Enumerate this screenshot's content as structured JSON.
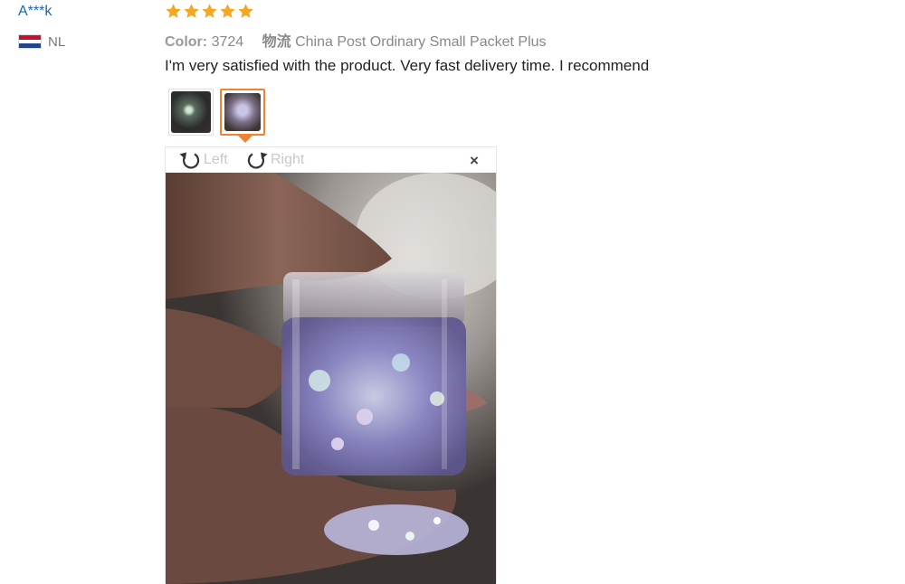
{
  "reviewer": {
    "name": "A***k",
    "country": "NL"
  },
  "rating": {
    "stars": 5,
    "color": "#f5a623"
  },
  "meta": {
    "color_label": "Color:",
    "color_value": "3724",
    "shipping_label": "物流",
    "shipping_value": "China Post Ordinary Small Packet Plus"
  },
  "review_text": "I'm very satisfied with the product. Very fast delivery time. I recommend",
  "thumbnails": [
    {
      "selected": false
    },
    {
      "selected": true
    }
  ],
  "viewer": {
    "rotate_left": "Left",
    "rotate_right": "Right",
    "close": "×"
  },
  "accent_color": "#f08233"
}
